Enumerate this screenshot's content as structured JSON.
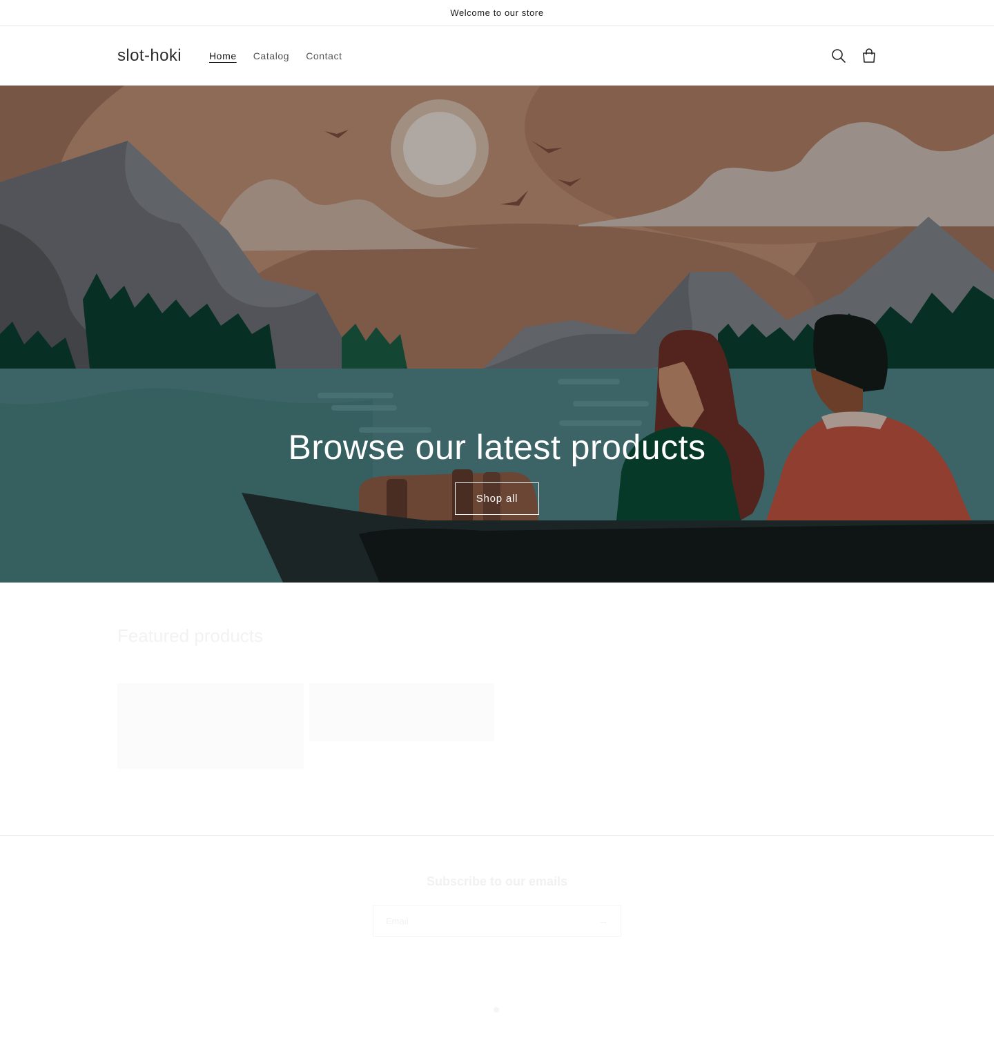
{
  "announcement": {
    "text": "Welcome to our store"
  },
  "header": {
    "logo": "slot-hoki",
    "nav": [
      {
        "label": "Home",
        "active": true
      },
      {
        "label": "Catalog",
        "active": false
      },
      {
        "label": "Contact",
        "active": false
      }
    ],
    "icons": [
      "search-icon",
      "cart-icon"
    ]
  },
  "hero": {
    "title": "Browse our latest products",
    "button_label": "Shop all"
  },
  "featured": {
    "title": "Featured products",
    "card_texts": [
      "",
      ""
    ]
  },
  "newsletter": {
    "title": "Subscribe to our emails",
    "email_placeholder": "Email",
    "arrow": "→"
  },
  "colors": {
    "sky": "#9a6f5a",
    "water": "#3d6a6d",
    "mountain": "#5a5c61",
    "forest": "#0b3d2e",
    "boat": "#1a2221"
  }
}
